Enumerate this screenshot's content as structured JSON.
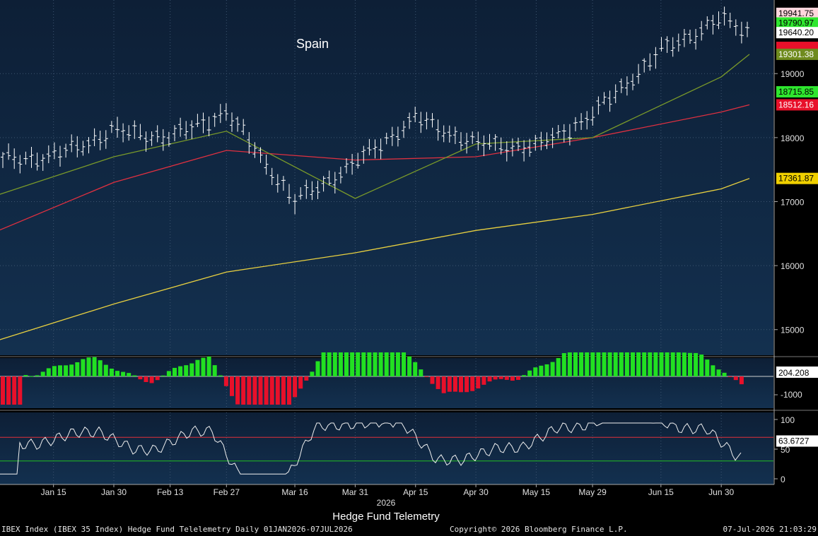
{
  "chart_data": {
    "type": "line",
    "title": "Spain",
    "x_label": "Hedge Fund Telemetry",
    "year_label": "2026",
    "x_ticks": [
      "Jan 15",
      "Jan 30",
      "Feb 13",
      "Feb 27",
      "Mar 16",
      "Mar 31",
      "Apr 15",
      "Apr 30",
      "May 15",
      "May 29",
      "Jun 15",
      "Jun 30"
    ],
    "price_axis": {
      "ticks": [
        15000,
        16000,
        17000,
        18000,
        19000
      ],
      "ylim": [
        14600,
        20150
      ]
    },
    "price_labels": [
      {
        "value": 19941.75,
        "text": "19941.75",
        "bg": "#ffd6dc",
        "fg": "#000000"
      },
      {
        "value": 19790.97,
        "text": "19790.97",
        "bg": "#2ee62e",
        "fg": "#000000"
      },
      {
        "value": 19640.2,
        "text": "19640.20",
        "bg": "#ffffff",
        "fg": "#000000"
      },
      {
        "value": 19410.0,
        "text": "",
        "bg": "#e8102a",
        "fg": "#ffffff"
      },
      {
        "value": 19301.38,
        "text": "19301.38",
        "bg": "#6f8b1e",
        "fg": "#ffffff"
      },
      {
        "value": 18715.85,
        "text": "18715.85",
        "bg": "#2ee62e",
        "fg": "#000000"
      },
      {
        "value": 18512.16,
        "text": "18512.16",
        "bg": "#e8102a",
        "fg": "#ffffff"
      },
      {
        "value": 17361.87,
        "text": "17361.87",
        "bg": "#f0d000",
        "fg": "#000000"
      }
    ],
    "series": [
      {
        "name": "",
        "kind": "ohlc",
        "color": "#ffffff",
        "x": [
          "2026-01-01",
          "2026-01-15",
          "2026-01-30",
          "2026-02-13",
          "2026-02-27",
          "2026-03-16",
          "2026-03-31",
          "2026-04-15",
          "2026-04-30",
          "2026-05-15",
          "2026-05-29",
          "2026-06-15",
          "2026-06-30",
          "2026-07-07"
        ],
        "close": [
          17650,
          17700,
          18100,
          18000,
          18400,
          17000,
          17600,
          18300,
          17900,
          17850,
          18350,
          19350,
          19850,
          19640
        ]
      },
      {
        "name": "",
        "kind": "line",
        "color": "#e03040",
        "x": [
          "2026-01-01",
          "2026-01-30",
          "2026-02-27",
          "2026-03-31",
          "2026-04-30",
          "2026-05-29",
          "2026-06-30",
          "2026-07-07"
        ],
        "values": [
          16540,
          17300,
          17800,
          17650,
          17700,
          18000,
          18400,
          18512.16
        ]
      },
      {
        "name": "",
        "kind": "line",
        "color": "#7a9a2a",
        "x": [
          "2026-01-01",
          "2026-01-30",
          "2026-02-27",
          "2026-03-31",
          "2026-04-30",
          "2026-05-29",
          "2026-06-30",
          "2026-07-07"
        ],
        "values": [
          17100,
          17700,
          18100,
          17050,
          17900,
          18000,
          18950,
          19301.38
        ]
      },
      {
        "name": "",
        "kind": "line",
        "color": "#e8d040",
        "x": [
          "2026-01-01",
          "2026-01-30",
          "2026-02-27",
          "2026-03-31",
          "2026-04-30",
          "2026-05-29",
          "2026-06-30",
          "2026-07-07"
        ],
        "values": [
          14830,
          15400,
          15900,
          16200,
          16550,
          16800,
          17200,
          17361.87
        ]
      }
    ],
    "momentum_panel": {
      "ticks": [
        -1000
      ],
      "last_label": "204.208"
    },
    "oscillator_panel": {
      "ticks": [
        100,
        50,
        0
      ],
      "last_label": "63.6727",
      "upper_band": 70,
      "lower_band": 30
    },
    "grid": true
  },
  "footer": {
    "left": "IBEX Index (IBEX 35 Index) Hedge Fund Telelemetry Daily 01JAN2026-07JUL2026",
    "center": "Copyright© 2026 Bloomberg Finance L.P.",
    "right": "07-Jul-2026 21:03:29"
  }
}
